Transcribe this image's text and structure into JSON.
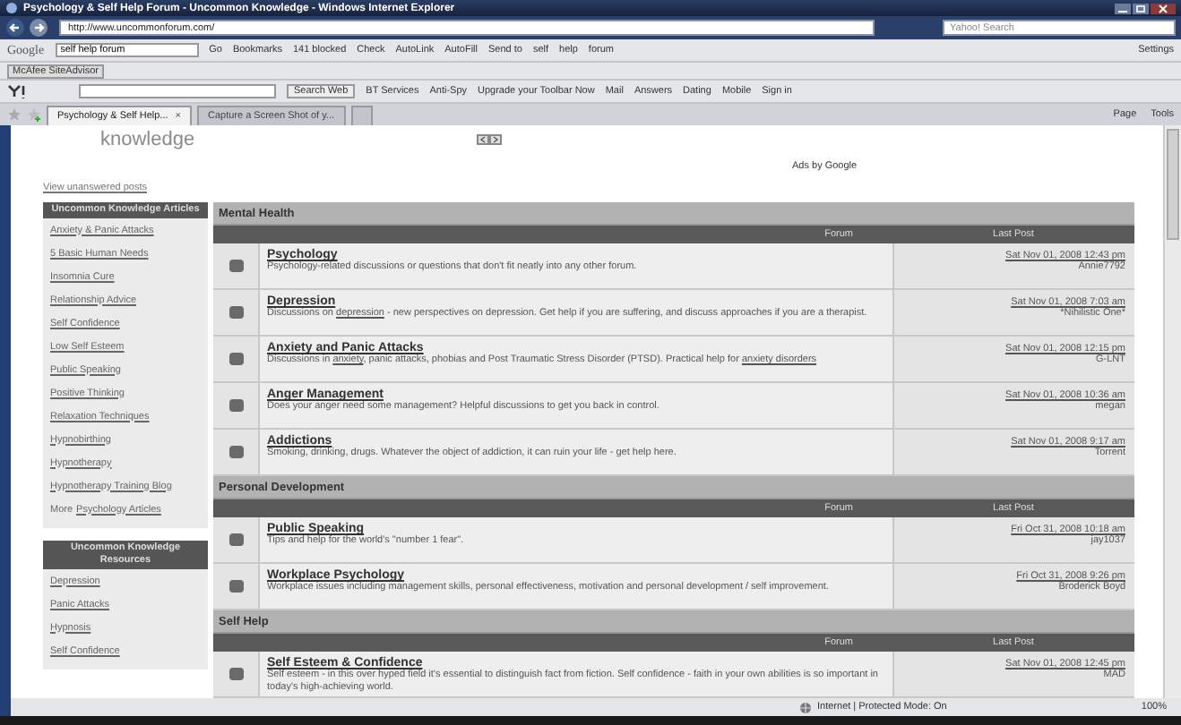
{
  "window": {
    "title": "Psychology & Self Help Forum - Uncommon Knowledge - Windows Internet Explorer"
  },
  "address_bar": {
    "url": "http://www.uncommonforum.com/",
    "search_placeholder": "Yahoo! Search"
  },
  "google_toolbar": {
    "logo": "Google",
    "query": "self help forum",
    "items": [
      "Go",
      "Bookmarks",
      "141 blocked",
      "Check",
      "AutoLink",
      "AutoFill",
      "Send to",
      "self",
      "help",
      "forum"
    ],
    "settings": "Settings"
  },
  "mcafee_toolbar": {
    "label": "McAfee SiteAdvisor"
  },
  "yahoo_toolbar": {
    "search_button": "Search Web",
    "items": [
      "BT Services",
      "Anti-Spy",
      "Upgrade your Toolbar Now",
      "Mail",
      "Answers",
      "Dating",
      "Mobile",
      "Sign in"
    ]
  },
  "tabs": [
    {
      "label": "Psychology & Self Help...",
      "close": "×",
      "selected": true
    },
    {
      "label": "Capture a Screen Shot of y...",
      "selected": false
    }
  ],
  "command_bar": {
    "items": [
      "Page",
      "Tools"
    ]
  },
  "page": {
    "logo_text": "knowledge",
    "ads_label": "Ads by Google",
    "unanswered_link": "View unanswered posts",
    "sidebar": [
      {
        "title": "Uncommon Knowledge Articles",
        "items": [
          {
            "text": "Anxiety & Panic Attacks"
          },
          {
            "text": "5 Basic Human Needs"
          },
          {
            "text": "Insomnia Cure"
          },
          {
            "text": "Relationship Advice"
          },
          {
            "text": "Self Confidence"
          },
          {
            "text": "Low Self Esteem"
          },
          {
            "text": "Public Speaking"
          },
          {
            "text": "Positive Thinking"
          },
          {
            "text": "Relaxation Techniques"
          },
          {
            "text": "Hypnobirthing"
          },
          {
            "text": "Hypnotherapy"
          },
          {
            "text": "Hypnotherapy Training Blog"
          },
          {
            "prefix": "More",
            "text": "Psychology Articles"
          }
        ]
      },
      {
        "title": "Uncommon Knowledge Resources",
        "items": [
          {
            "text": "Depression"
          },
          {
            "text": "Panic Attacks"
          },
          {
            "text": "Hypnosis"
          },
          {
            "text": "Self Confidence"
          }
        ]
      }
    ],
    "sections": [
      {
        "title": "Mental Health",
        "columns": [
          "Forum",
          "Last Post"
        ],
        "forums": [
          {
            "name": "Psychology",
            "description": [
              {
                "text": "Psychology-related discussions or questions that don't fit neatly into any other forum.",
                "link": false
              }
            ],
            "last_post": "Sat Nov 01, 2008 12:43 pm",
            "last_user": "Annie7792"
          },
          {
            "name": "Depression",
            "description": [
              {
                "text": "Discussions on ",
                "link": false
              },
              {
                "text": "depression",
                "link": true
              },
              {
                "text": " - new perspectives on depression. Get help if you are suffering, and discuss approaches if you are a therapist.",
                "link": false
              }
            ],
            "last_post": "Sat Nov 01, 2008 7:03 am",
            "last_user": "*Nihilistic One*"
          },
          {
            "name": "Anxiety and Panic Attacks",
            "description": [
              {
                "text": "Discussions in ",
                "link": false
              },
              {
                "text": "anxiety",
                "link": true
              },
              {
                "text": ", panic attacks, phobias and Post Traumatic Stress Disorder (PTSD). Practical help for ",
                "link": false
              },
              {
                "text": "anxiety disorders",
                "link": true
              }
            ],
            "last_post": "Sat Nov 01, 2008 12:15 pm",
            "last_user": "G-LNT"
          },
          {
            "name": "Anger Management",
            "description": [
              {
                "text": "Does your anger need some management? Helpful discussions to get you back in control.",
                "link": false
              }
            ],
            "last_post": "Sat Nov 01, 2008 10:36 am",
            "last_user": "megan"
          },
          {
            "name": "Addictions",
            "description": [
              {
                "text": "Smoking, drinking, drugs. Whatever the object of addiction, it can ruin your life - get help here.",
                "link": false
              }
            ],
            "last_post": "Sat Nov 01, 2008 9:17 am",
            "last_user": "Torrent"
          }
        ]
      },
      {
        "title": "Personal Development",
        "columns": [
          "Forum",
          "Last Post"
        ],
        "forums": [
          {
            "name": "Public Speaking",
            "description": [
              {
                "text": "Tips and help for the world's \"number 1 fear\".",
                "link": false
              }
            ],
            "last_post": "Fri Oct 31, 2008 10:18 am",
            "last_user": "jay1037"
          },
          {
            "name": "Workplace Psychology",
            "description": [
              {
                "text": "Workplace issues including management skills, personal effectiveness, motivation and personal development / self improvement.",
                "link": false
              }
            ],
            "last_post": "Fri Oct 31, 2008 9:26 pm",
            "last_user": "Broderick Boyd"
          }
        ]
      },
      {
        "title": "Self Help",
        "columns": [
          "Forum",
          "Last Post"
        ],
        "forums": [
          {
            "name": "Self Esteem & Confidence",
            "description": [
              {
                "text": "Self esteem - in this over hyped field it's essential to distinguish fact from fiction. Self confidence - faith in your own abilities is so important in today's high-achieving world.",
                "link": false
              }
            ],
            "last_post": "Sat Nov 01, 2008 12:45 pm",
            "last_user": "MAD"
          }
        ]
      }
    ]
  },
  "status_bar": {
    "zone": "Internet | Protected Mode: On",
    "zoom": "100%"
  }
}
